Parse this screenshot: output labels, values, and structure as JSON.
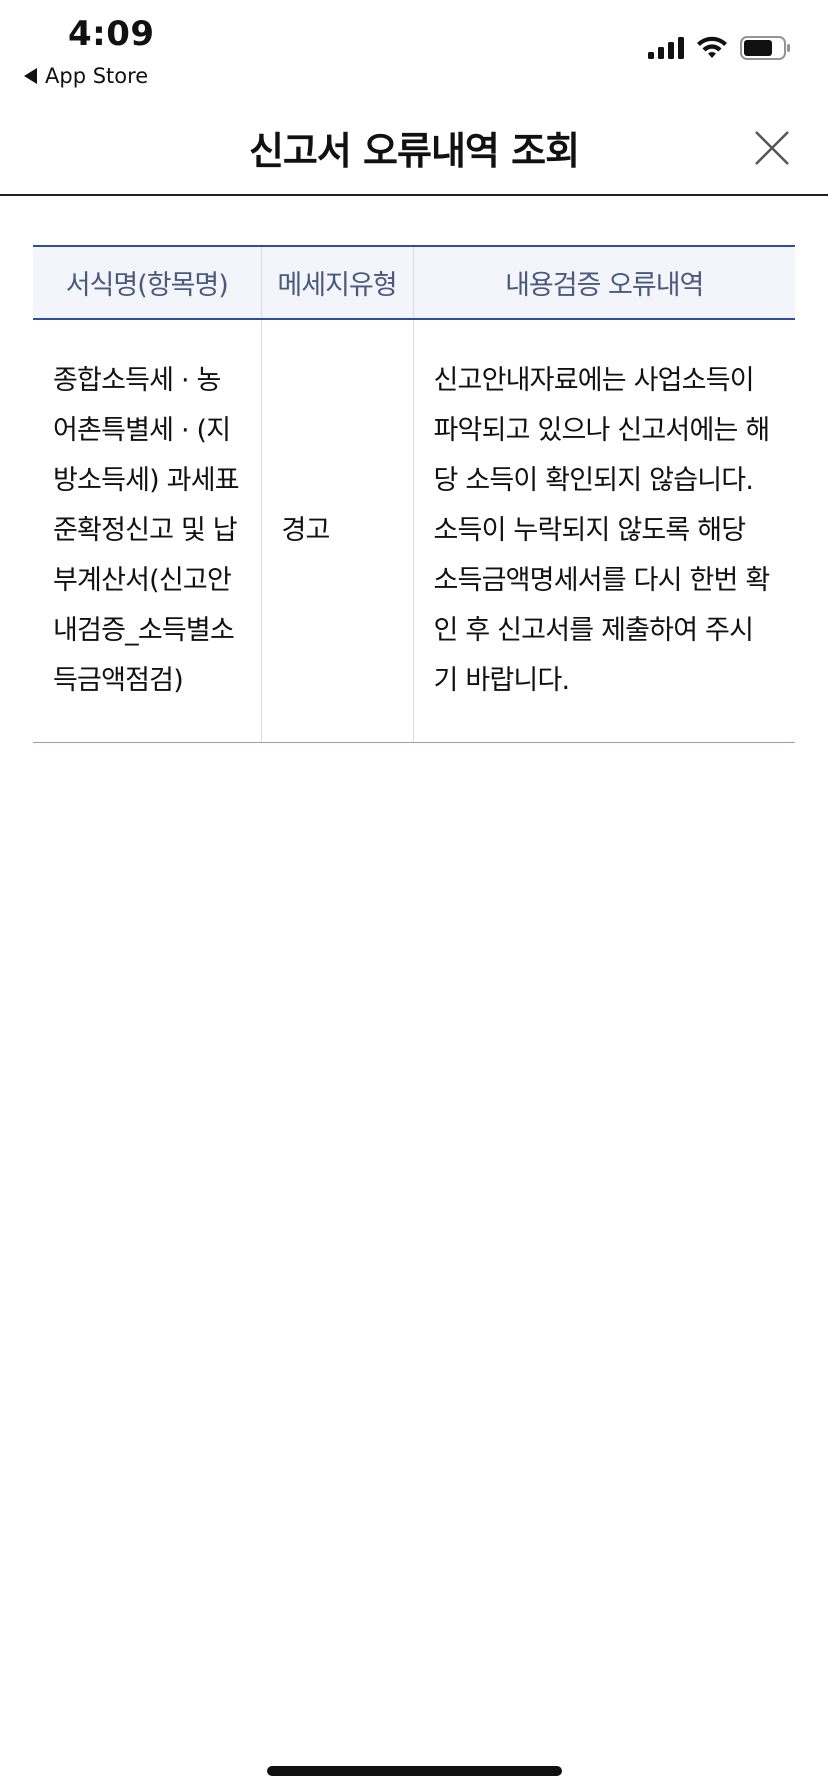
{
  "status_bar": {
    "time": "4:09",
    "back_label": "App Store",
    "icons": [
      "cellular-signal-icon",
      "wifi-icon",
      "battery-icon"
    ]
  },
  "header": {
    "title": "신고서 오류내역 조회",
    "close_icon": "close-icon"
  },
  "table": {
    "columns": [
      "서식명(항목명)",
      "메세지유형",
      "내용검증 오류내역"
    ],
    "rows": [
      {
        "form_name": "종합소득세 · 농어촌특별세 · (지방소득세) 과세표준확정신고 및 납부계산서(신고안내검증_소득별소득금액점검)",
        "message_type": "경고",
        "content": "신고안내자료에는 사업소득이 파악되고 있으나 신고서에는 해당 소득이 확인되지 않습니다. 소득이 누락되지 않도록 해당 소득금액명세서를 다시 한번 확인 후 신고서를 제출하여 주시기 바랍니다."
      }
    ]
  },
  "colors": {
    "header_border": "#2c4f9c",
    "header_bg": "#f3f5fa",
    "header_text": "#4a5a7e"
  }
}
